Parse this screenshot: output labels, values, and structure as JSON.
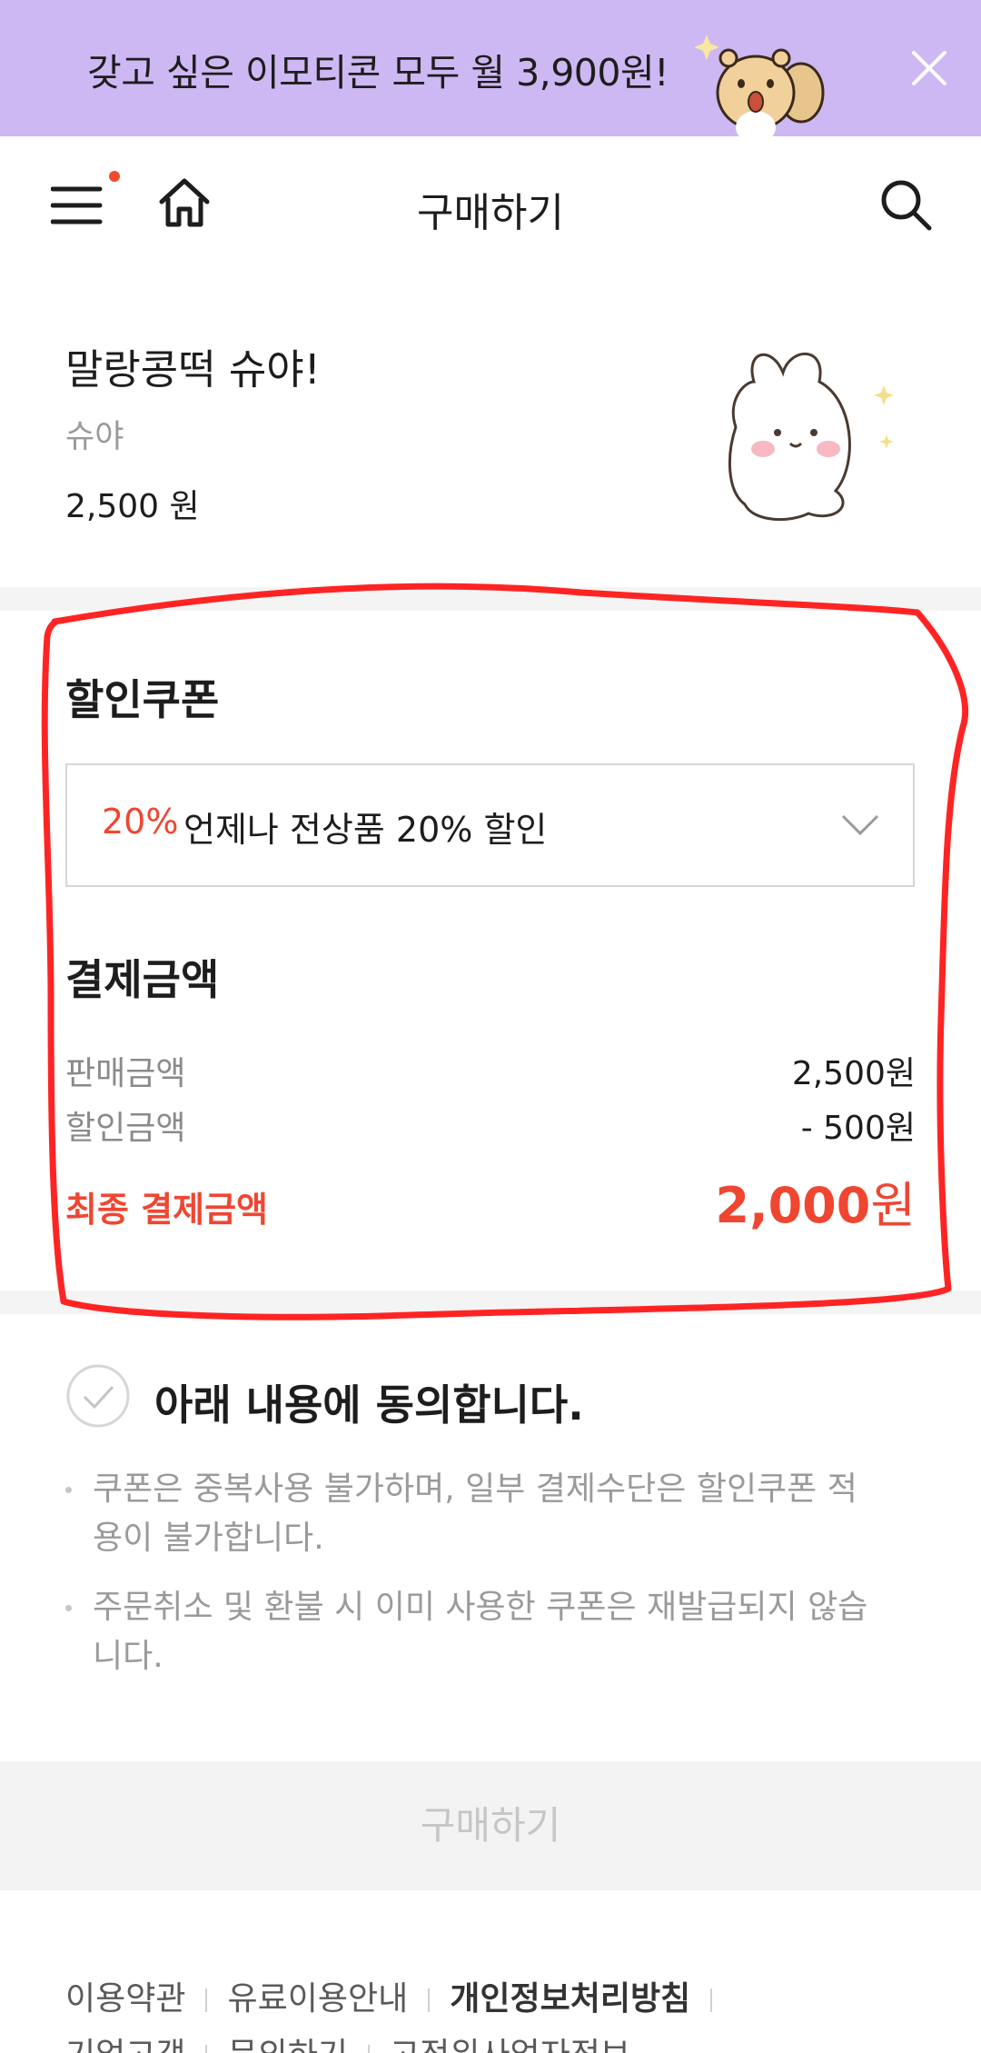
{
  "promo_banner": {
    "text": "갖고 싶은 이모티콘 모두 월 3,900원!",
    "background": "#cdb8f3"
  },
  "header": {
    "title": "구매하기",
    "icons": [
      "menu-icon",
      "home-icon",
      "search-icon"
    ],
    "notification_dot_color": "#f0492e"
  },
  "product": {
    "title": "말랑콩떡 슈야!",
    "artist": "슈야",
    "price": "2,500 원"
  },
  "coupon": {
    "heading": "할인쿠폰",
    "selected_rate": "20%",
    "selected_name": "언제나 전상품 20% 할인"
  },
  "payment": {
    "heading": "결제금액",
    "rows": [
      {
        "label": "판매금액",
        "value": "2,500원"
      },
      {
        "label": "할인금액",
        "value": "- 500원"
      }
    ],
    "final_label": "최종 결제금액",
    "final_amount": "2,000",
    "final_unit": "원"
  },
  "agreement": {
    "label": "아래 내용에 동의합니다.",
    "checked": false,
    "notes": [
      "쿠폰은 중복사용 불가하며, 일부 결제수단은 할인쿠폰 적용이 불가합니다.",
      "주문취소 및 환불 시 이미 사용한 쿠폰은 재발급되지 않습니다."
    ]
  },
  "buy_button": {
    "label": "구매하기"
  },
  "footer": {
    "links": [
      "이용약관",
      "유료이용안내",
      "개인정보처리방침"
    ],
    "links_row2": [
      "기업고객",
      "문의하기",
      "고정위사업자정보"
    ]
  },
  "colors": {
    "accent_red": "#ef4632",
    "annotation_red": "#ff2424"
  }
}
